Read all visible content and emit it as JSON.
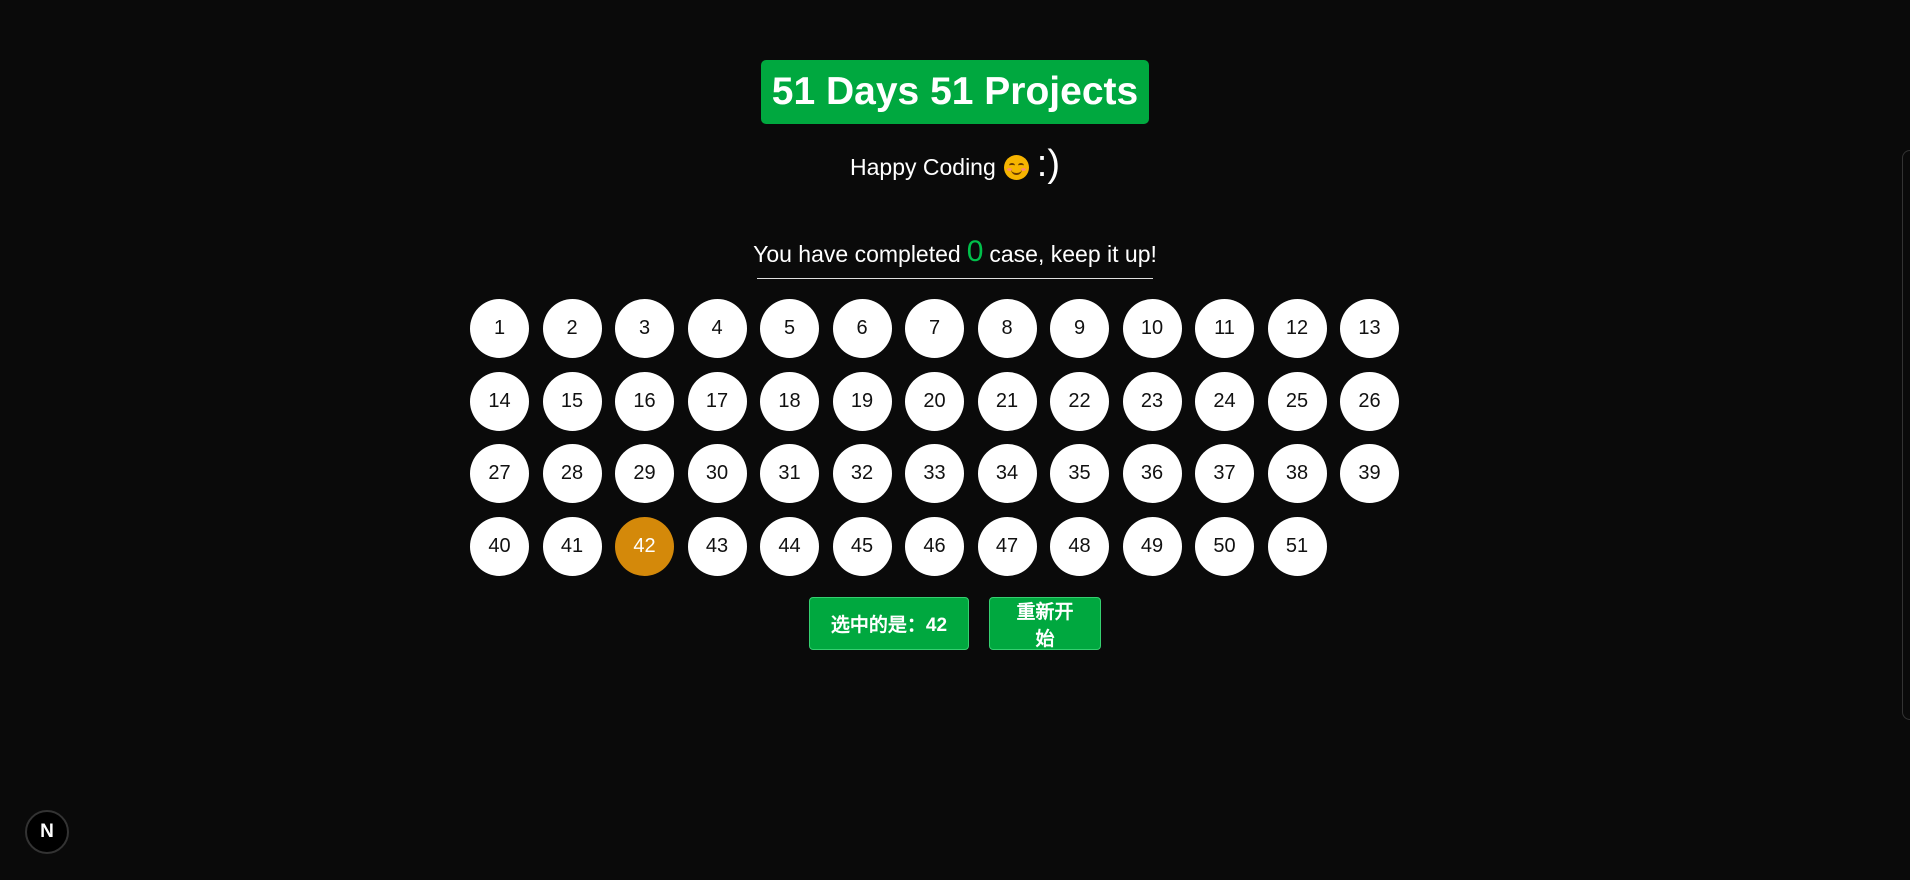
{
  "header": {
    "title": "51 Days 51 Projects",
    "subtitle": "Happy Coding",
    "subtitle_emoticon": ":)",
    "emoji_icon": "smiling-face-icon"
  },
  "progress": {
    "prefix": "You have completed",
    "count": "0",
    "suffix": "case, keep it up!"
  },
  "projects": {
    "numbers": [
      1,
      2,
      3,
      4,
      5,
      6,
      7,
      8,
      9,
      10,
      11,
      12,
      13,
      14,
      15,
      16,
      17,
      18,
      19,
      20,
      21,
      22,
      23,
      24,
      25,
      26,
      27,
      28,
      29,
      30,
      31,
      32,
      33,
      34,
      35,
      36,
      37,
      38,
      39,
      40,
      41,
      42,
      43,
      44,
      45,
      46,
      47,
      48,
      49,
      50,
      51
    ],
    "selected": 42
  },
  "actions": {
    "selected_label": "选中的是：42",
    "restart_label": "重新开始"
  },
  "footer": {
    "logo_text": "N"
  },
  "colors": {
    "accent": "#00a83f",
    "selected": "#d4890a",
    "background": "#0a0a0a",
    "count": "#00c04b"
  }
}
